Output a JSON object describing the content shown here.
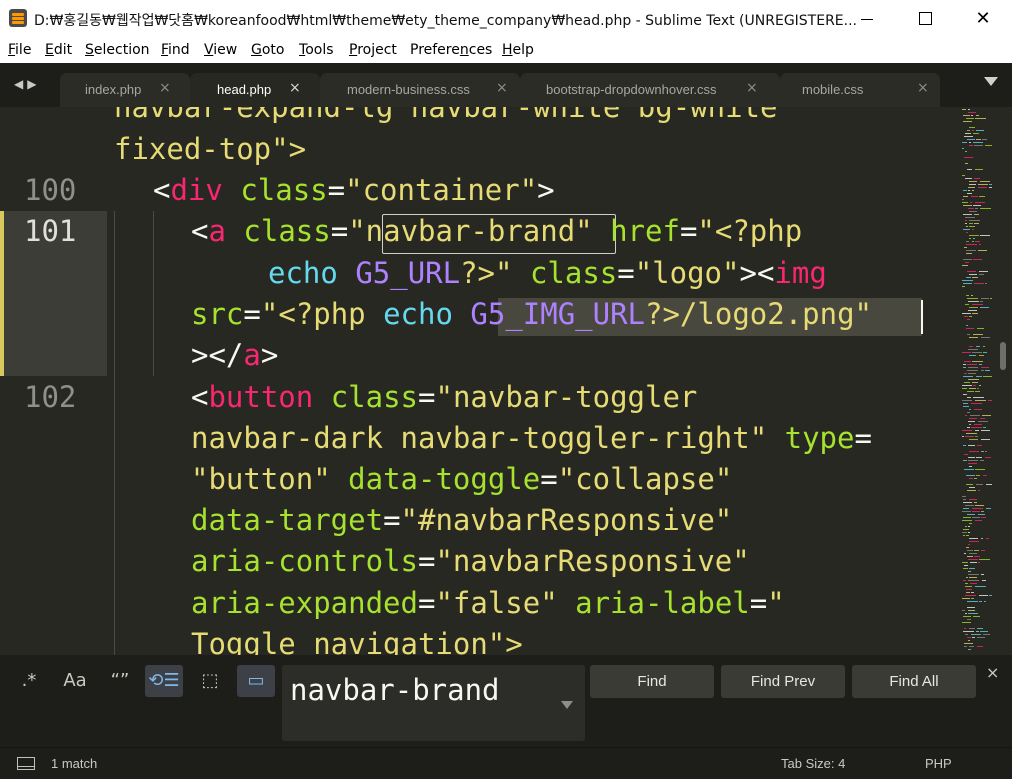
{
  "window": {
    "title": "D:₩홍길동₩웹작업₩닷홈₩koreanfood₩html₩theme₩ety_theme_company₩head.php - Sublime Text (UNREGISTERE...",
    "close_glyph": "✕"
  },
  "menu": [
    {
      "key": "F",
      "rest": "ile"
    },
    {
      "key": "E",
      "rest": "dit"
    },
    {
      "key": "S",
      "rest": "election"
    },
    {
      "key": "F",
      "rest": "ind"
    },
    {
      "key": "V",
      "rest": "iew"
    },
    {
      "key": "G",
      "rest": "oto"
    },
    {
      "key": "T",
      "rest": "ools"
    },
    {
      "key": "P",
      "rest": "roject"
    },
    {
      "key": "n",
      "pre": "Prefere",
      "rest": "ces"
    },
    {
      "key": "H",
      "rest": "elp"
    }
  ],
  "tabs": [
    {
      "label": "index.php",
      "active": false
    },
    {
      "label": "head.php",
      "active": true
    },
    {
      "label": "modern-business.css",
      "active": false
    },
    {
      "label": "bootstrap-dropdownhover.css",
      "active": false
    },
    {
      "label": "mobile.css",
      "active": false
    }
  ],
  "tab_close_glyph": "×",
  "nav_arrows": "◀▶",
  "editor": {
    "line_numbers": [
      "100",
      "101",
      "102"
    ],
    "current_line": "101",
    "code": {
      "l0": [
        "navbar-expand-lg navbar-white bg-white"
      ],
      "l1": [
        "fixed-top\">"
      ],
      "l2": [
        "<",
        "div",
        " ",
        "class",
        "=",
        "\"container\"",
        ">"
      ],
      "l3": [
        "<",
        "a",
        " ",
        "class",
        "=",
        "\"navbar-brand\"",
        " ",
        "href",
        "=",
        "\"<?php"
      ],
      "l4": [
        "echo",
        " ",
        "G5_URL",
        "?>\"",
        " ",
        "class",
        "=",
        "\"logo\"",
        "><",
        "img"
      ],
      "l5": [
        "src",
        "=",
        "\"<?php",
        " ",
        "echo",
        " ",
        "G5_IMG_URL",
        "?>/logo2.png\""
      ],
      "l6": [
        "></",
        "a",
        ">"
      ],
      "l7": [
        "<",
        "button",
        " ",
        "class",
        "=",
        "\"navbar-toggler"
      ],
      "l8": [
        "navbar-dark navbar-toggler-right\"",
        " ",
        "type",
        "="
      ],
      "l9": [
        "\"button\"",
        " ",
        "data-toggle",
        "=",
        "\"collapse\""
      ],
      "l10": [
        "data-target",
        "=",
        "\"#navbarResponsive\""
      ],
      "l11": [
        "aria-controls",
        "=",
        "\"navbarResponsive\""
      ],
      "l12": [
        "aria-expanded",
        "=",
        "\"false\"",
        " ",
        "aria-label",
        "=",
        "\""
      ],
      "l13": [
        "Toggle navigation\">"
      ]
    }
  },
  "find_panel": {
    "options": [
      {
        "label": ".*",
        "name": "regex-toggle",
        "on": false
      },
      {
        "label": "Aa",
        "name": "case-sensitive-toggle",
        "on": false
      },
      {
        "label": "“”",
        "name": "whole-word-toggle",
        "on": false
      },
      {
        "label": "⟲☰",
        "name": "wrap-toggle",
        "on": true
      },
      {
        "label": "⬚",
        "name": "in-selection-toggle",
        "on": false
      },
      {
        "label": "▭",
        "name": "highlight-matches-toggle",
        "on": true
      }
    ],
    "query": "navbar-brand",
    "buttons": {
      "find": "Find",
      "find_prev": "Find Prev",
      "find_all": "Find All"
    },
    "close_glyph": "×"
  },
  "status": {
    "matches": "1 match",
    "tab_size": "Tab Size: 4",
    "syntax": "PHP"
  },
  "colors": {
    "background": "#272822",
    "tag": "#f92672",
    "attribute": "#a6e22e",
    "string": "#e6db74",
    "php_keyword": "#66d9ef",
    "constant": "#ae81ff",
    "gutter_marker": "#d8c85e"
  }
}
